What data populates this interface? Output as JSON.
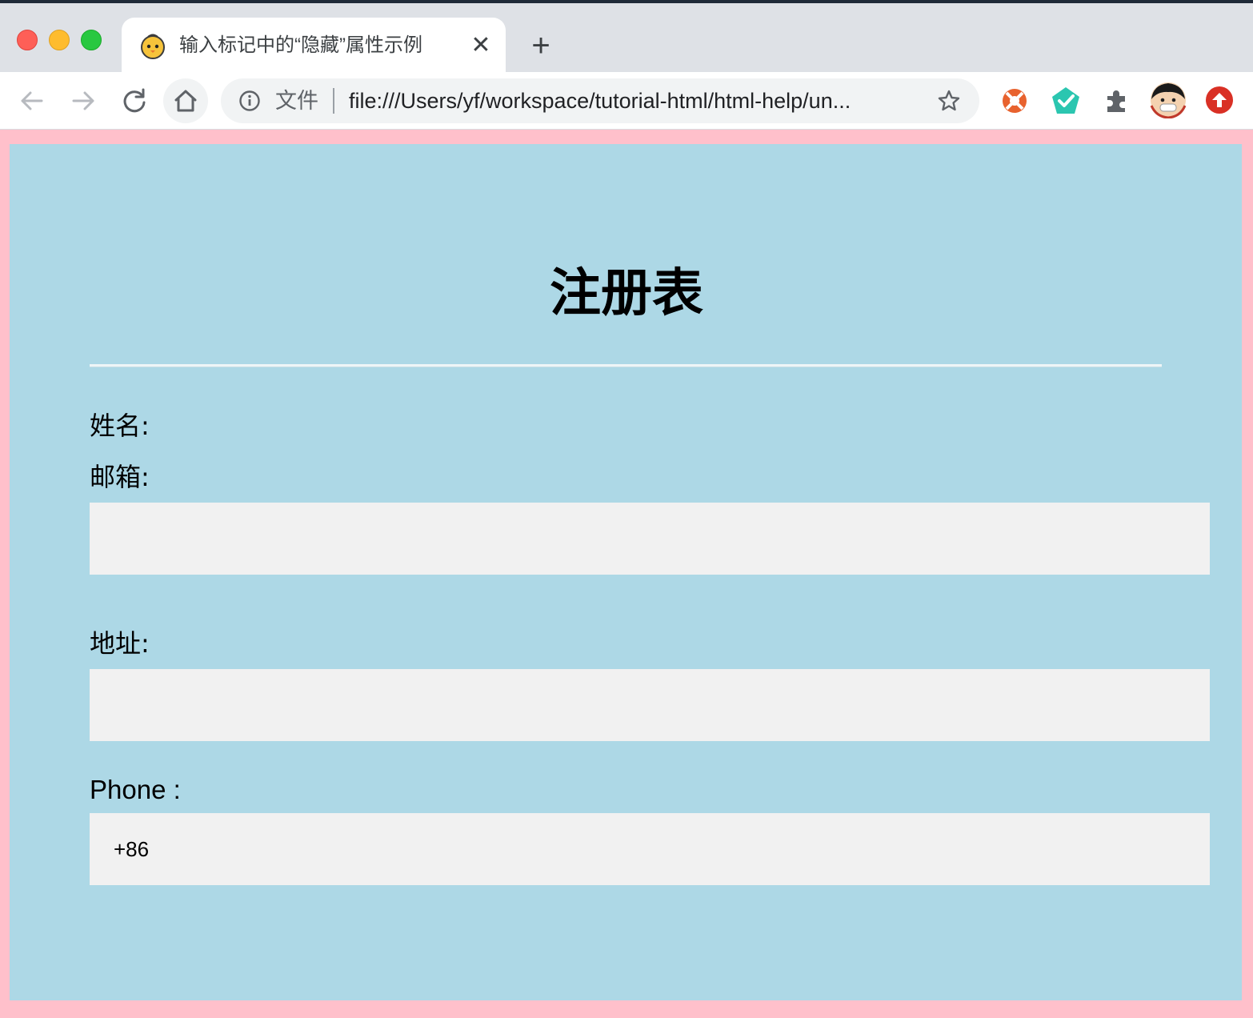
{
  "browser": {
    "tab": {
      "title": "输入标记中的“隐藏”属性示例",
      "close": "✕"
    },
    "new_tab": "+",
    "omnibox": {
      "chip": "文件",
      "url": "file:///Users/yf/workspace/tutorial-html/html-help/un..."
    }
  },
  "form": {
    "title": "注册表",
    "name_label": "姓名:",
    "email_label": "邮箱:",
    "address_label": "地址:",
    "phone_label": "Phone :",
    "email_value": "",
    "address_value": "",
    "phone_value": "+86"
  },
  "colors": {
    "page_border": "#ffc0cb",
    "page_background": "#add8e6",
    "field_background": "#f1f1f1"
  }
}
